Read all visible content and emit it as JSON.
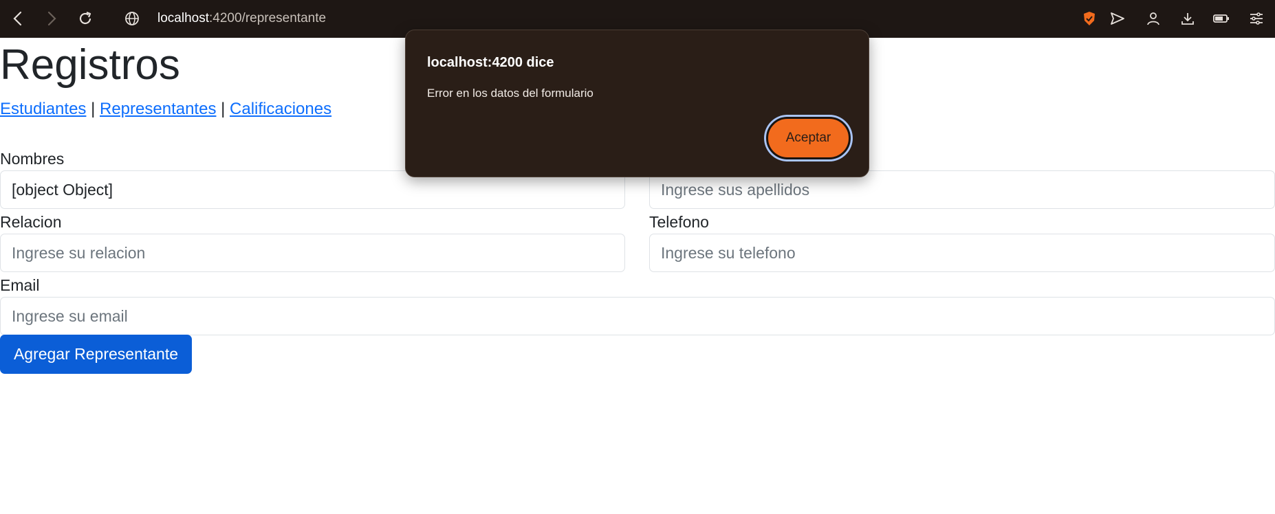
{
  "browser": {
    "url_host": "localhost",
    "url_rest": ":4200/representante",
    "icons": [
      "back-icon",
      "forward-icon",
      "reload-icon",
      "site-info-icon",
      "brave-shield-icon",
      "send-icon",
      "profile-icon",
      "download-icon",
      "battery-icon",
      "menu-icon"
    ],
    "accent_color": "#f26b1d"
  },
  "page": {
    "title": "Registros",
    "nav": {
      "estudiantes": "Estudiantes",
      "representantes": "Representantes",
      "calificaciones": "Calificaciones",
      "separator": "|"
    }
  },
  "form": {
    "nombres": {
      "label": "Nombres",
      "value": "[object Object]",
      "placeholder": ""
    },
    "apellidos": {
      "label": "",
      "value": "",
      "placeholder": "Ingrese sus apellidos"
    },
    "relacion": {
      "label": "Relacion",
      "value": "",
      "placeholder": "Ingrese su relacion"
    },
    "telefono": {
      "label": "Telefono",
      "value": "",
      "placeholder": "Ingrese su telefono"
    },
    "email": {
      "label": "Email",
      "value": "",
      "placeholder": "Ingrese su email"
    },
    "submit_label": "Agregar Representante",
    "submit_color": "#0b5ed7"
  },
  "dialog": {
    "title": "localhost:4200 dice",
    "message": "Error en los datos del formulario",
    "ok_label": "Aceptar"
  }
}
